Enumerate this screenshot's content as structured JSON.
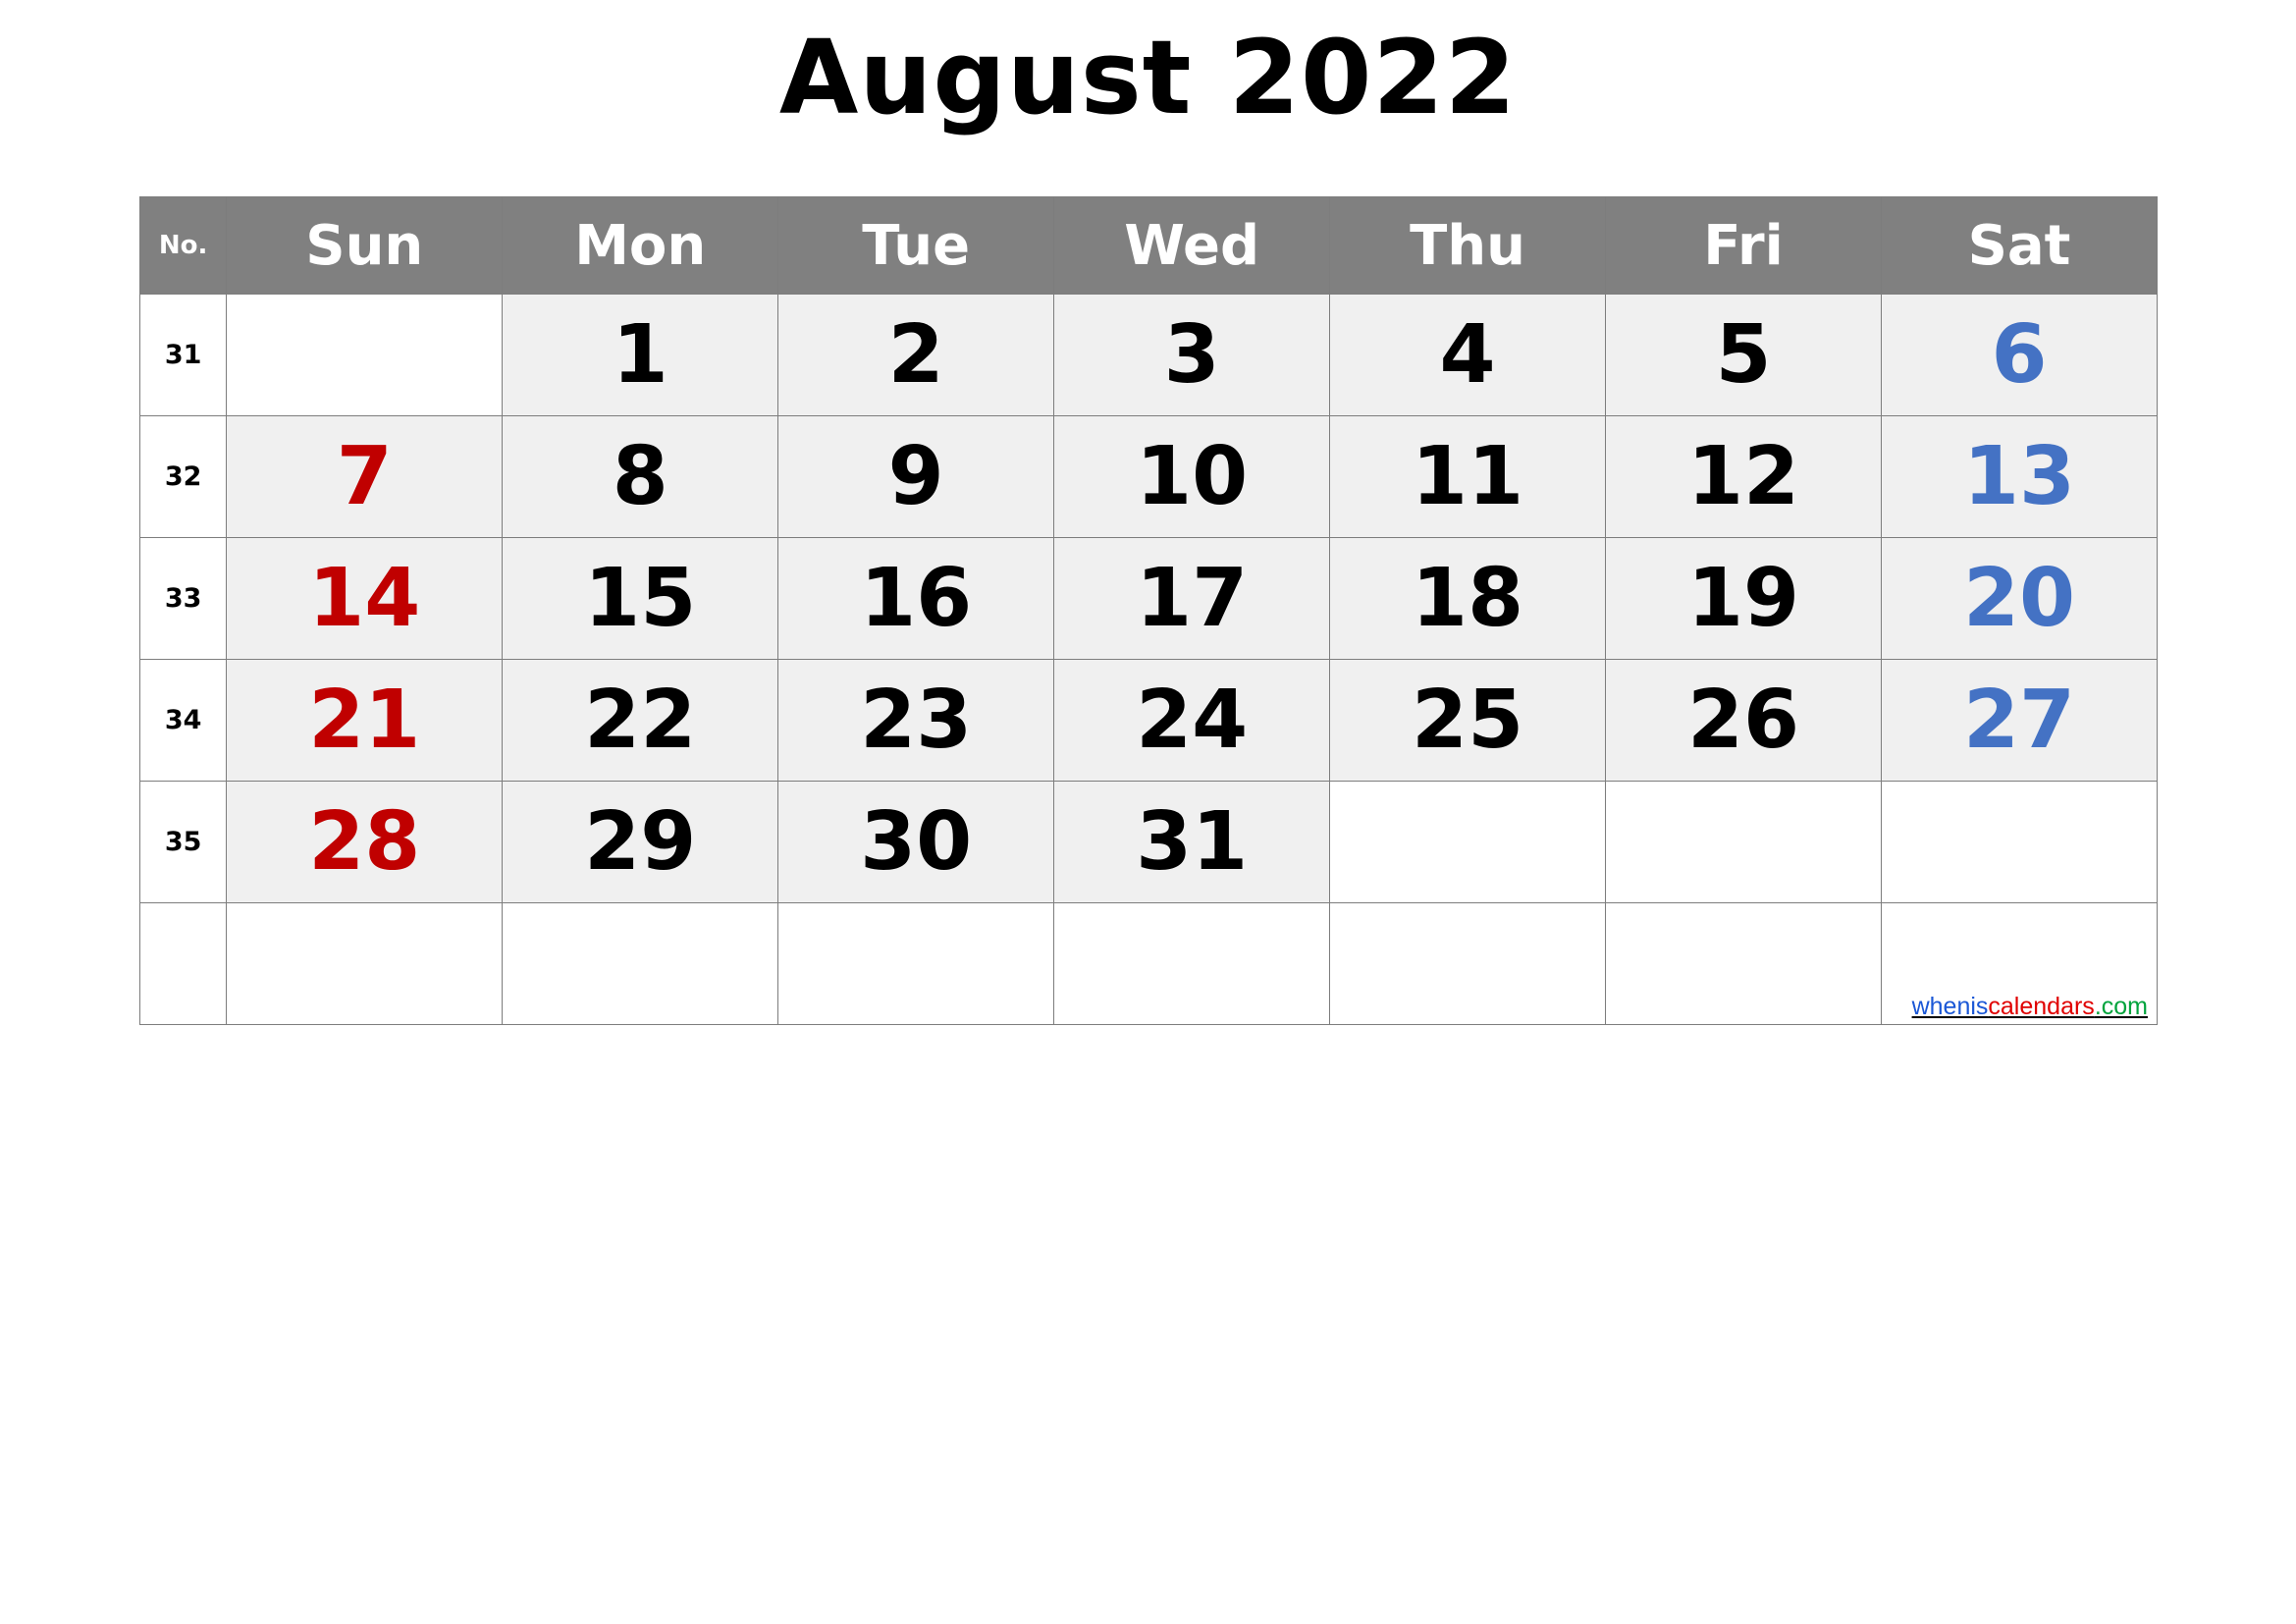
{
  "page": {
    "title": "August 2022",
    "month": "August",
    "year": "2022"
  },
  "colors": {
    "header_background": "#808080",
    "header_text": "#ffffff",
    "cell_background": "#f0f0f0",
    "empty_cell_background": "#ffffff",
    "grid_line": "#7d7d7d",
    "sunday_text": "#c00000",
    "saturday_text": "#4472c4",
    "weekday_text": "#000000"
  },
  "header": {
    "weekno_label": "No.",
    "days": [
      "Sun",
      "Mon",
      "Tue",
      "Wed",
      "Thu",
      "Fri",
      "Sat"
    ]
  },
  "weeks": [
    {
      "no": "31",
      "days": [
        "",
        "1",
        "2",
        "3",
        "4",
        "5",
        "6"
      ]
    },
    {
      "no": "32",
      "days": [
        "7",
        "8",
        "9",
        "10",
        "11",
        "12",
        "13"
      ]
    },
    {
      "no": "33",
      "days": [
        "14",
        "15",
        "16",
        "17",
        "18",
        "19",
        "20"
      ]
    },
    {
      "no": "34",
      "days": [
        "21",
        "22",
        "23",
        "24",
        "25",
        "26",
        "27"
      ]
    },
    {
      "no": "35",
      "days": [
        "28",
        "29",
        "30",
        "31",
        "",
        "",
        ""
      ]
    },
    {
      "no": "",
      "days": [
        "",
        "",
        "",
        "",
        "",
        "",
        ""
      ]
    }
  ],
  "watermark": {
    "part1": "whenis",
    "part2": "calendars",
    "part3": ".com"
  }
}
